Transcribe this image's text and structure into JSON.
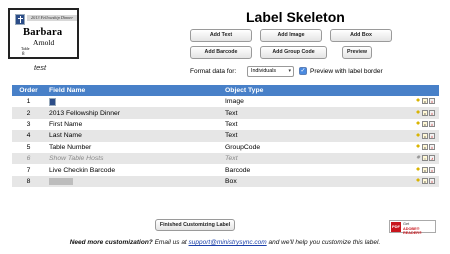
{
  "preview": {
    "event_name": "2013 Fellowship Dinner",
    "first_name": "Barbara",
    "last_name": "Arnold",
    "table_label": "Table",
    "table_number": "8",
    "caption": "test"
  },
  "page_title": "Label Skeleton",
  "buttons": {
    "add_text": "Add Text",
    "add_image": "Add Image",
    "add_box": "Add Box",
    "add_barcode": "Add Barcode",
    "add_group_code": "Add Group Code",
    "preview": "Preview",
    "finished": "Finished Customizing Label"
  },
  "format": {
    "label": "Format data for:",
    "selected": "Individuals"
  },
  "preview_border": {
    "label": "Preview with label border",
    "checked": true
  },
  "table": {
    "headers": [
      "Order",
      "Field Name",
      "Object Type"
    ],
    "rows": [
      {
        "order": "1",
        "field": "",
        "type": "Image",
        "disabled": false
      },
      {
        "order": "2",
        "field": "2013 Fellowship Dinner",
        "type": "Text",
        "disabled": false
      },
      {
        "order": "3",
        "field": "First Name",
        "type": "Text",
        "disabled": false
      },
      {
        "order": "4",
        "field": "Last Name",
        "type": "Text",
        "disabled": false
      },
      {
        "order": "5",
        "field": "Table Number",
        "type": "GroupCode",
        "disabled": false
      },
      {
        "order": "6",
        "field": "Show Table Hosts",
        "type": "Text",
        "disabled": true
      },
      {
        "order": "7",
        "field": "Live Checkin Barcode",
        "type": "Barcode",
        "disabled": false
      },
      {
        "order": "8",
        "field": "",
        "type": "Box",
        "disabled": false
      }
    ]
  },
  "adobe_badge": {
    "line1": "Get",
    "line2": "ADOBE® READER®",
    "logo_text": "PDF"
  },
  "footer": {
    "bold_text": "Need more customization?",
    "text_before": " Email us at ",
    "email": "support@ministrysync.com",
    "text_after": " and we'll help you customize this label."
  }
}
